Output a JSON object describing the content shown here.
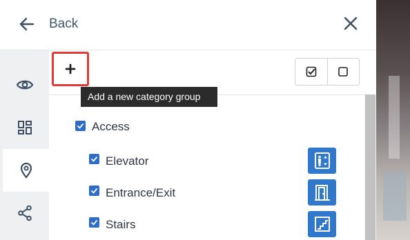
{
  "header": {
    "back_label": "Back"
  },
  "toolbar": {
    "add_tooltip": "Add a new category group"
  },
  "rail": {
    "items": [
      {
        "icon": "eye-icon",
        "active": false
      },
      {
        "icon": "dashboard-icon",
        "active": false
      },
      {
        "icon": "location-pin-icon",
        "active": true
      },
      {
        "icon": "share-icon",
        "active": false
      }
    ]
  },
  "categories": {
    "group": {
      "label": "Access",
      "checked": true
    },
    "items": [
      {
        "label": "Elevator",
        "checked": true,
        "icon": "elevator-icon"
      },
      {
        "label": "Entrance/Exit",
        "checked": true,
        "icon": "door-icon"
      },
      {
        "label": "Stairs",
        "checked": true,
        "icon": "stairs-icon"
      }
    ]
  },
  "colors": {
    "accent": "#2f78cc",
    "checkbox": "#2d6cc7",
    "highlight_border": "#e23b34"
  }
}
